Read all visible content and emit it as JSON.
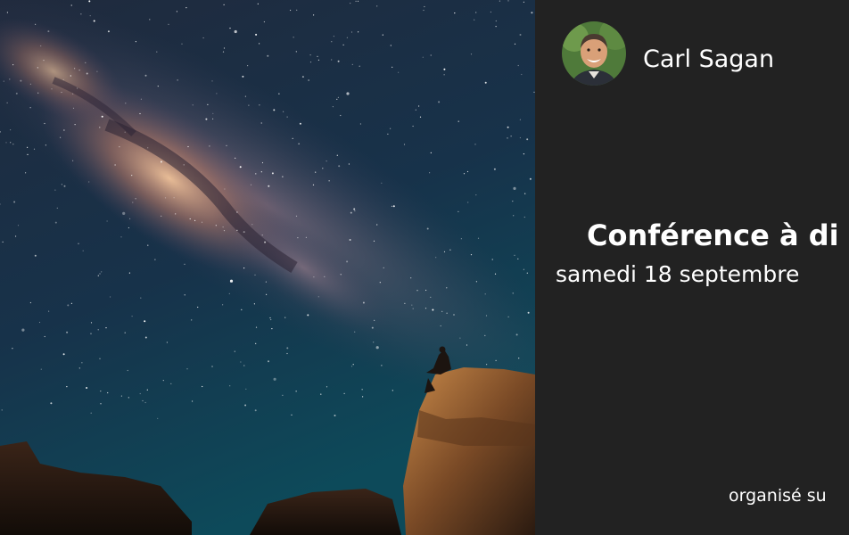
{
  "hero": {
    "image": "milky-way-night-sky-photo"
  },
  "host": {
    "name": "Carl Sagan",
    "avatar_icon": "host-portrait"
  },
  "event": {
    "title": "Conférence à di",
    "date": "samedi 18 septembre",
    "organizer": "organisé su"
  },
  "colors": {
    "panel_background": "#222222",
    "text": "#ffffff"
  }
}
